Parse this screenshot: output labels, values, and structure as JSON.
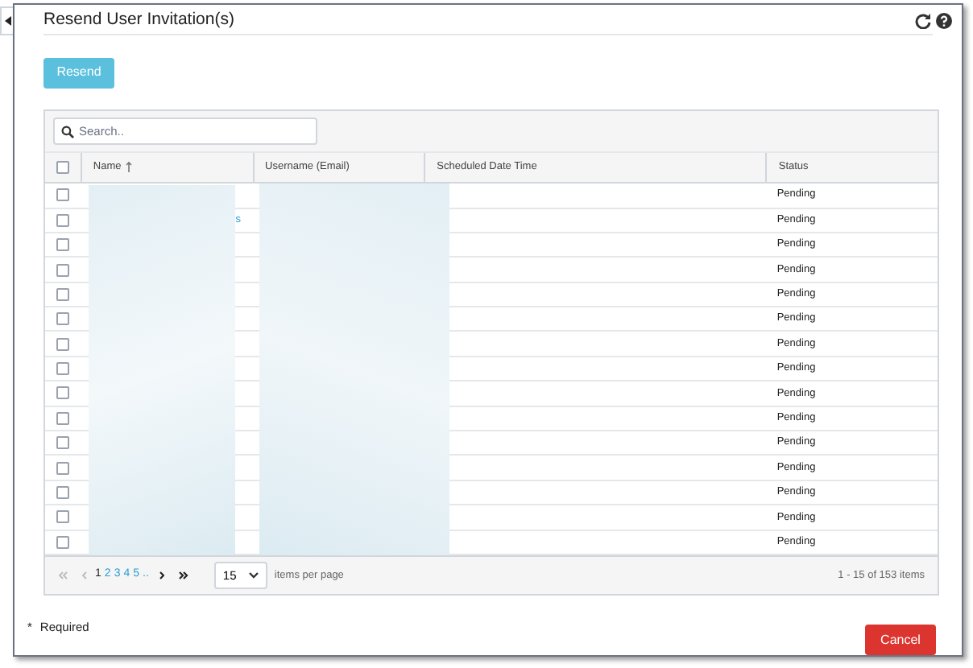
{
  "dialog": {
    "title": "Resend User Invitation(s)"
  },
  "actions": {
    "resend": "Resend",
    "cancel": "Cancel"
  },
  "search": {
    "placeholder": "Search.."
  },
  "table": {
    "all_checked": false,
    "columns": [
      {
        "label": "Name",
        "sorted": true
      },
      {
        "label": "Username (Email)",
        "sorted": false
      },
      {
        "label": "Scheduled Date Time",
        "sorted": false
      },
      {
        "label": "Status",
        "sorted": false
      }
    ],
    "rows": [
      {
        "checked": false,
        "status": "Pending"
      },
      {
        "checked": false,
        "name_fragment": "s",
        "status": "Pending"
      },
      {
        "checked": false,
        "status": "Pending"
      },
      {
        "checked": false,
        "status": "Pending"
      },
      {
        "checked": false,
        "status": "Pending"
      },
      {
        "checked": false,
        "status": "Pending"
      },
      {
        "checked": false,
        "status": "Pending"
      },
      {
        "checked": false,
        "status": "Pending"
      },
      {
        "checked": false,
        "status": "Pending"
      },
      {
        "checked": false,
        "status": "Pending"
      },
      {
        "checked": false,
        "status": "Pending"
      },
      {
        "checked": false,
        "status": "Pending"
      },
      {
        "checked": false,
        "status": "Pending"
      },
      {
        "checked": false,
        "status": "Pending"
      },
      {
        "checked": false,
        "status": "Pending"
      }
    ]
  },
  "pager": {
    "pages": [
      {
        "label": "1",
        "selected": true
      },
      {
        "label": "2",
        "selected": false
      },
      {
        "label": "3",
        "selected": false
      },
      {
        "label": "4",
        "selected": false
      },
      {
        "label": "5",
        "selected": false
      },
      {
        "label": "..",
        "selected": false
      }
    ],
    "page_size": "15",
    "page_size_label": "items per page",
    "summary": "1 - 15 of 153 items"
  },
  "footer": {
    "required_mark": "*",
    "required_label": "Required"
  }
}
